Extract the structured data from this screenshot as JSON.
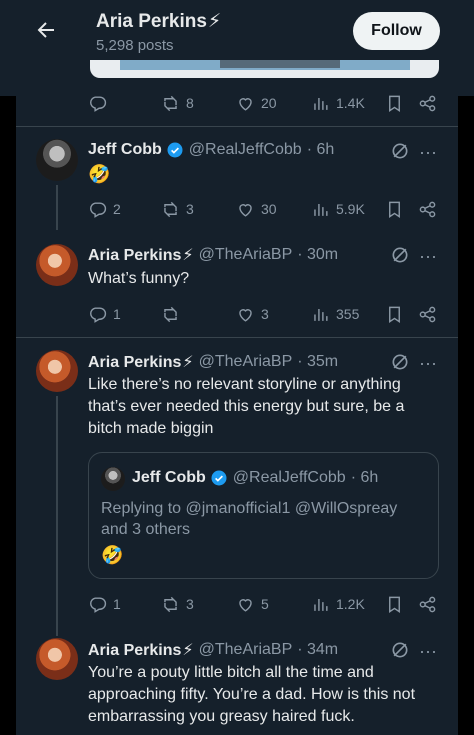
{
  "header": {
    "name": "Aria Perkins",
    "bolt": "⚡",
    "posts": "5,298 posts",
    "follow_label": "Follow"
  },
  "top_actions": {
    "replies": "",
    "reposts": "8",
    "likes": "20",
    "views": "1.4K"
  },
  "tweets": [
    {
      "name": "Jeff Cobb",
      "handle": "@RealJeffCobb",
      "time": "· 6h",
      "text": "🤣",
      "actions": {
        "replies": "2",
        "reposts": "3",
        "likes": "30",
        "views": "5.9K"
      }
    },
    {
      "name": "Aria Perkins",
      "bolt": "⚡",
      "handle": "@TheAriaBP",
      "time": "· 30m",
      "text": "What’s funny?",
      "actions": {
        "replies": "1",
        "reposts": "",
        "likes": "3",
        "views": "355"
      }
    },
    {
      "name": "Aria Perkins",
      "bolt": "⚡",
      "handle": "@TheAriaBP",
      "time": "· 35m",
      "text": "Like there’s no relevant storyline or anything that’s ever needed this energy but sure, be a bitch made biggin",
      "quote": {
        "name": "Jeff Cobb",
        "handle": "@RealJeffCobb",
        "time": "· 6h",
        "text": "Replying to @jmanofficial1 @WillOspreay and 3 others",
        "emoji": "🤣"
      },
      "actions": {
        "replies": "1",
        "reposts": "3",
        "likes": "5",
        "views": "1.2K"
      }
    },
    {
      "name": "Aria Perkins",
      "bolt": "⚡",
      "handle": "@TheAriaBP",
      "time": "· 34m",
      "text": "You’re a pouty little bitch all the time and approaching fifty. You’re a dad. How is this not embarrassing you greasy haired fuck."
    }
  ],
  "colors": {
    "background": "#15202b",
    "divider": "#38444d",
    "text_primary": "#e7e9ea",
    "text_secondary": "#8b98a5",
    "verified": "#1d9bf0",
    "follow_button": "#eff3f4"
  },
  "icons": [
    "back-arrow-icon",
    "reply-icon",
    "repost-icon",
    "like-icon",
    "views-icon",
    "bookmark-icon",
    "share-icon",
    "grok-icon",
    "more-icon",
    "verified-icon"
  ]
}
